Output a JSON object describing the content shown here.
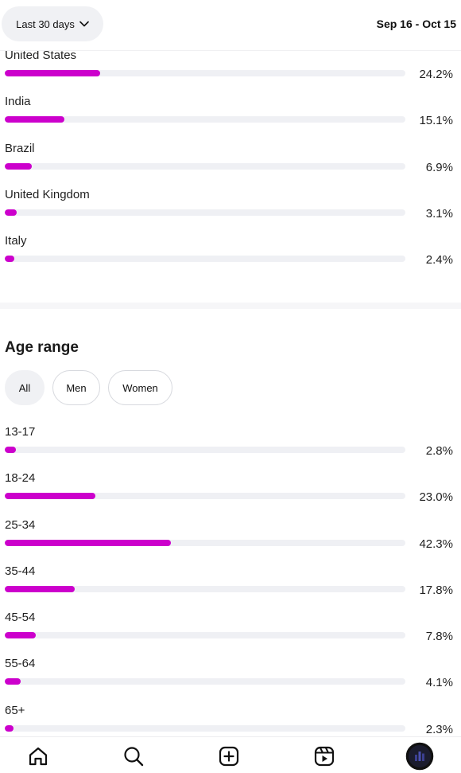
{
  "header": {
    "range_label": "Last 30 days",
    "date_range": "Sep 16 - Oct 15"
  },
  "countries": [
    {
      "label": "United States",
      "percent_text": "24.2%",
      "value": 24.2
    },
    {
      "label": "India",
      "percent_text": "15.1%",
      "value": 15.1
    },
    {
      "label": "Brazil",
      "percent_text": "6.9%",
      "value": 6.9
    },
    {
      "label": "United Kingdom",
      "percent_text": "3.1%",
      "value": 3.1
    },
    {
      "label": "Italy",
      "percent_text": "2.4%",
      "value": 2.4
    }
  ],
  "age_section": {
    "title": "Age range",
    "filters": [
      "All",
      "Men",
      "Women"
    ],
    "selected_filter": "All"
  },
  "ages": [
    {
      "label": "13-17",
      "percent_text": "2.8%",
      "value": 2.8
    },
    {
      "label": "18-24",
      "percent_text": "23.0%",
      "value": 23.0
    },
    {
      "label": "25-34",
      "percent_text": "42.3%",
      "value": 42.3
    },
    {
      "label": "35-44",
      "percent_text": "17.8%",
      "value": 17.8
    },
    {
      "label": "45-54",
      "percent_text": "7.8%",
      "value": 7.8
    },
    {
      "label": "55-64",
      "percent_text": "4.1%",
      "value": 4.1
    },
    {
      "label": "65+",
      "percent_text": "2.3%",
      "value": 2.3
    }
  ],
  "bar_color": "#cc00cc",
  "nav": {
    "items": [
      "home-icon",
      "search-icon",
      "create-icon",
      "reels-icon",
      "insights-profile-icon"
    ]
  }
}
